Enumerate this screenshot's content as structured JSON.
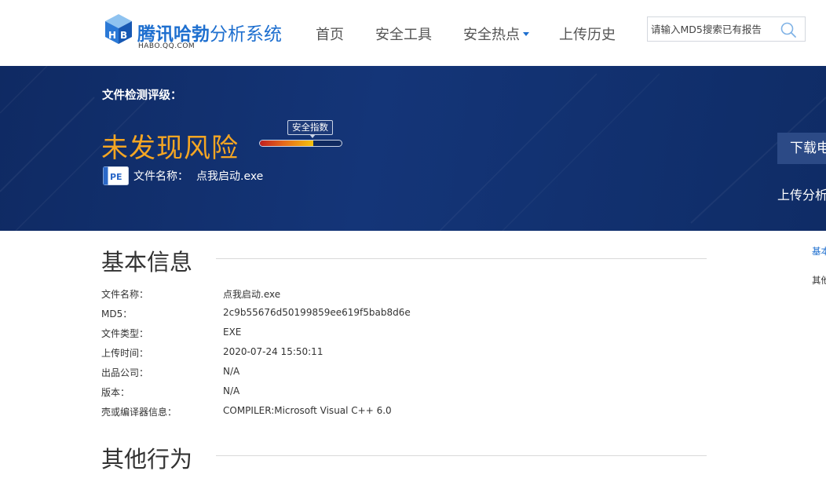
{
  "header": {
    "logo": {
      "title_strong": "腾讯哈勃",
      "title_light": "分析系统",
      "subtitle": "HABO.QQ.COM"
    },
    "nav": [
      {
        "label": "首页"
      },
      {
        "label": "安全工具"
      },
      {
        "label": "安全热点"
      },
      {
        "label": "上传历史"
      }
    ],
    "search": {
      "placeholder": "请输入MD5搜索已有报告",
      "value": ""
    }
  },
  "banner": {
    "level_label": "文件检测评级：",
    "verdict": "未发现风险",
    "index_tag": "安全指数",
    "safety_index_fraction": 0.65,
    "file_icon": "PE",
    "file_label": "文件名称：",
    "file_name": "点我启动.exe",
    "download_button": "下载电",
    "upload_link": "上传分析"
  },
  "basic_info": {
    "title": "基本信息",
    "rows": [
      {
        "key": "文件名称：",
        "value": "点我启动.exe"
      },
      {
        "key": "MD5：",
        "value": "2c9b55676d50199859ee619f5bab8d6e"
      },
      {
        "key": "文件类型：",
        "value": "EXE"
      },
      {
        "key": "上传时间：",
        "value": "2020-07-24 15:50:11"
      },
      {
        "key": "出品公司：",
        "value": "N/A"
      },
      {
        "key": "版本：",
        "value": "N/A"
      },
      {
        "key": "壳或编译器信息：",
        "value": "COMPILER:Microsoft Visual C++ 6.0"
      }
    ]
  },
  "other_behavior": {
    "title": "其他行为"
  },
  "side_nav": [
    {
      "label": "基本"
    },
    {
      "label": "其他"
    }
  ],
  "colors": {
    "brand": "#1e6fcf",
    "banner_bg": "#143578",
    "verdict": "#f5a623"
  },
  "icons": {
    "logo": "habo-cube-logo",
    "search": "search-icon",
    "caret": "caret-down-icon",
    "file": "pe-file-icon"
  }
}
